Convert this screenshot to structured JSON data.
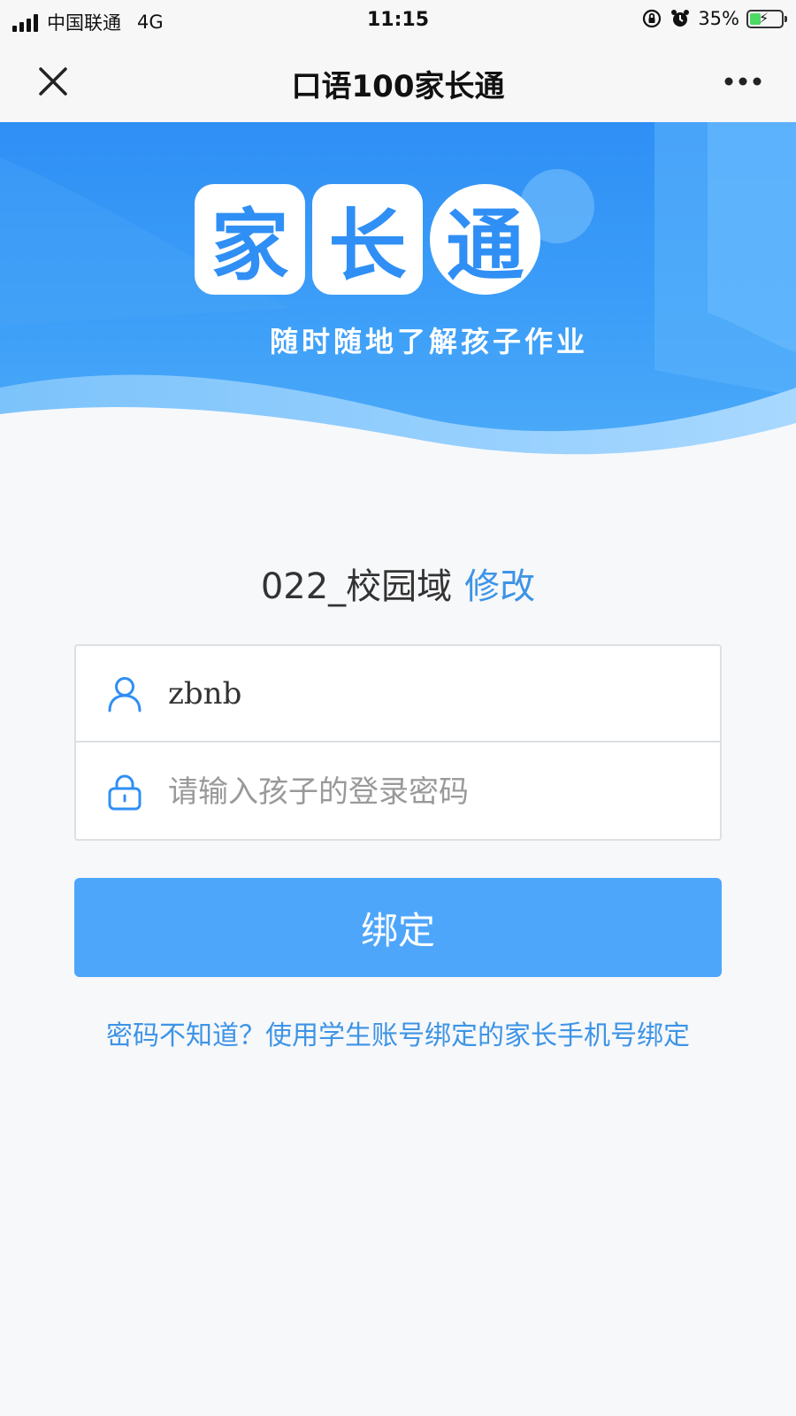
{
  "status_bar": {
    "carrier": "中国联通",
    "network": "4G",
    "time": "11:15",
    "battery_percent": "35%",
    "battery_level": 0.35,
    "icons": [
      "signal-icon",
      "rotation-lock-icon",
      "alarm-icon",
      "battery-charging-icon"
    ]
  },
  "nav": {
    "title": "口语100家长通",
    "close_icon": "close-icon",
    "more_icon": "more-icon"
  },
  "banner": {
    "logo_chars": [
      "家",
      "长",
      "通"
    ],
    "slogan": "随时随地了解孩子作业"
  },
  "school": {
    "domain": "022_校园域",
    "edit_label": "修改"
  },
  "form": {
    "username_value": "zbnb",
    "password_placeholder": "请输入孩子的登录密码",
    "user_icon": "user-icon",
    "lock_icon": "lock-icon"
  },
  "actions": {
    "bind_label": "绑定",
    "help_link": "密码不知道？使用学生账号绑定的家长手机号绑定"
  },
  "colors": {
    "accent": "#3d94e6",
    "button": "#4ea6fb",
    "banner": "#2f8ff5"
  }
}
